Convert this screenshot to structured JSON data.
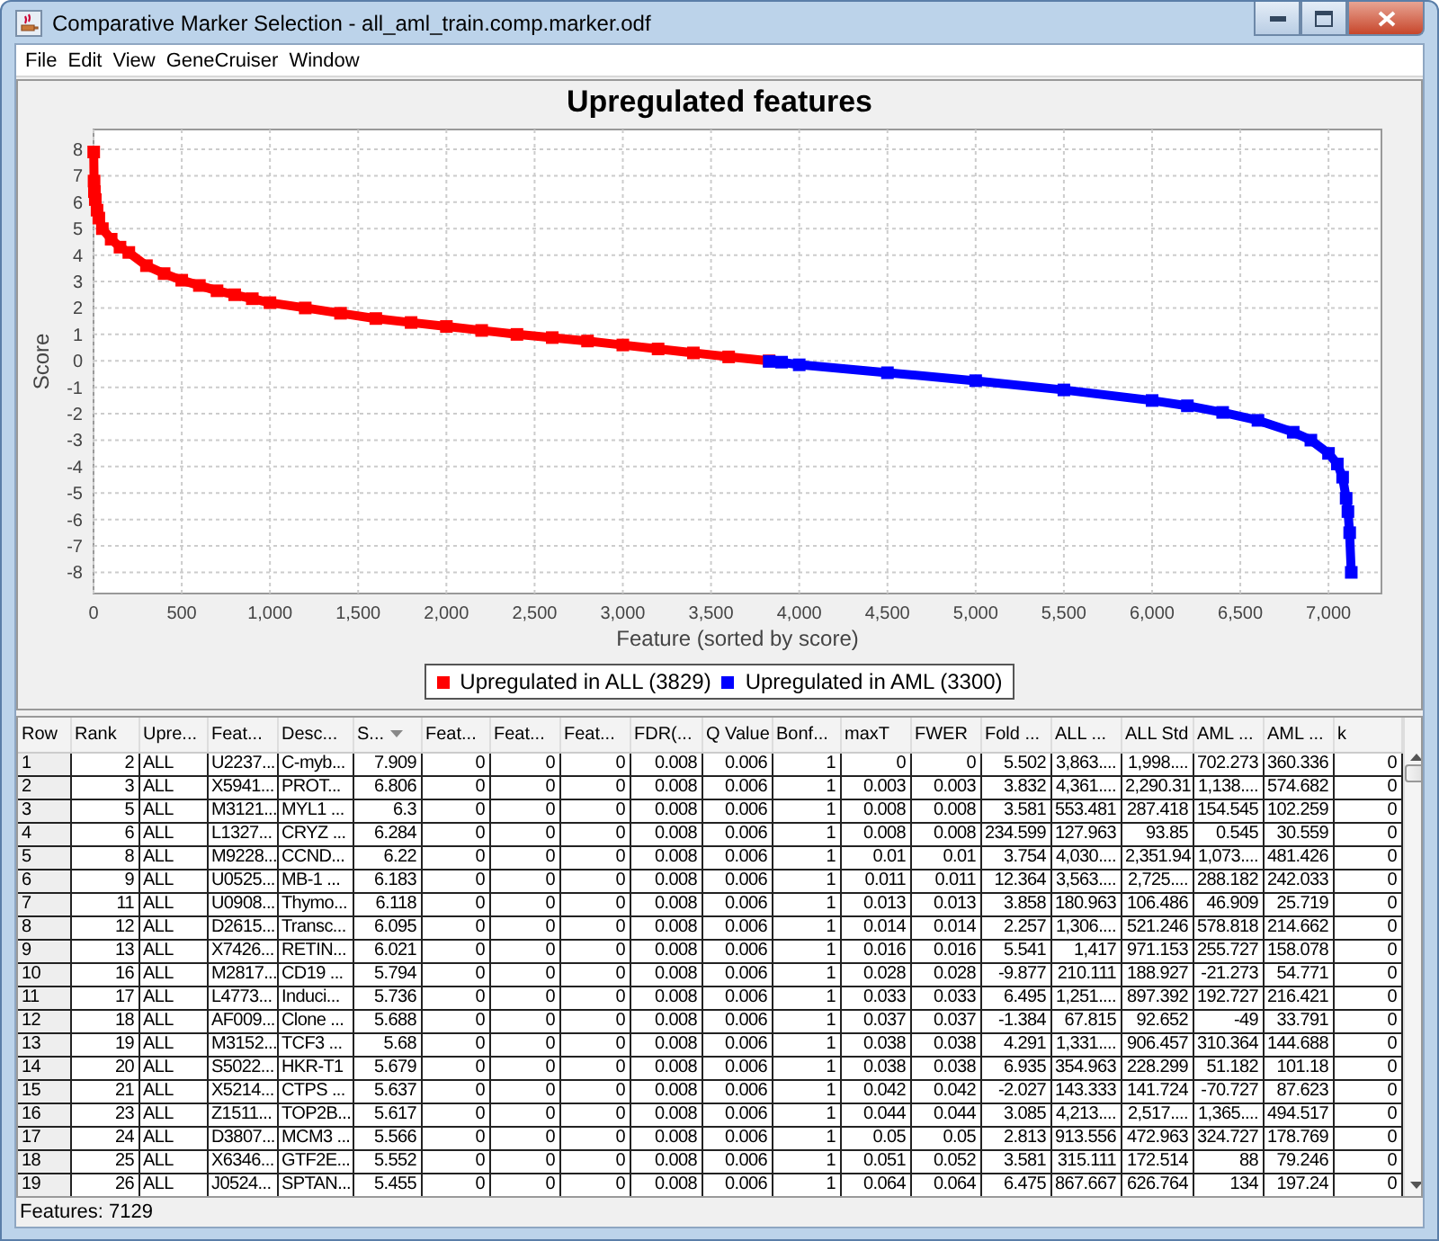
{
  "window": {
    "title": "Comparative Marker Selection - all_aml_train.comp.marker.odf"
  },
  "menu": [
    "File",
    "Edit",
    "View",
    "GeneCruiser",
    "Window"
  ],
  "chart": {
    "chart_data": {
      "type": "line",
      "title": "Upregulated features",
      "xlabel": "Feature (sorted by score)",
      "ylabel": "Score",
      "grid": true,
      "x": [
        1,
        3,
        5,
        10,
        20,
        30,
        50,
        100,
        150,
        200,
        300,
        400,
        500,
        600,
        700,
        800,
        900,
        1000,
        1200,
        1400,
        1600,
        1800,
        2000,
        2200,
        2400,
        2600,
        2800,
        3000,
        3200,
        3400,
        3600,
        3829,
        3830,
        3900,
        4000,
        4500,
        5000,
        5500,
        6000,
        6200,
        6400,
        6600,
        6800,
        6900,
        7000,
        7050,
        7080,
        7100,
        7110,
        7120,
        7129
      ],
      "series": [
        {
          "name": "Upregulated in ALL (3829)",
          "color": "#ff0000",
          "marker": "square",
          "values": [
            7.9,
            6.8,
            6.4,
            6.1,
            5.7,
            5.4,
            5.0,
            4.6,
            4.3,
            4.1,
            3.6,
            3.3,
            3.05,
            2.85,
            2.65,
            2.5,
            2.35,
            2.2,
            2.0,
            1.8,
            1.6,
            1.45,
            1.3,
            1.15,
            1.0,
            0.88,
            0.75,
            0.6,
            0.45,
            0.3,
            0.15,
            0.0,
            null,
            null,
            null,
            null,
            null,
            null,
            null,
            null,
            null,
            null,
            null,
            null,
            null,
            null,
            null,
            null,
            null,
            null,
            null
          ]
        },
        {
          "name": "Upregulated in AML (3300)",
          "color": "#0000ff",
          "marker": "square",
          "values": [
            null,
            null,
            null,
            null,
            null,
            null,
            null,
            null,
            null,
            null,
            null,
            null,
            null,
            null,
            null,
            null,
            null,
            null,
            null,
            null,
            null,
            null,
            null,
            null,
            null,
            null,
            null,
            null,
            null,
            null,
            null,
            null,
            -0.02,
            -0.05,
            -0.15,
            -0.45,
            -0.75,
            -1.1,
            -1.5,
            -1.7,
            -1.95,
            -2.25,
            -2.7,
            -3.0,
            -3.5,
            -3.9,
            -4.4,
            -5.2,
            -5.7,
            -6.5,
            -8.0
          ]
        }
      ],
      "xlim": [
        0,
        7300
      ],
      "ylim": [
        -8.8,
        8.75
      ],
      "xticks": [
        {
          "value": 0,
          "label": "0"
        },
        {
          "value": 500,
          "label": "500"
        },
        {
          "value": 1000,
          "label": "1,000"
        },
        {
          "value": 1500,
          "label": "1,500"
        },
        {
          "value": 2000,
          "label": "2,000"
        },
        {
          "value": 2500,
          "label": "2,500"
        },
        {
          "value": 3000,
          "label": "3,000"
        },
        {
          "value": 3500,
          "label": "3,500"
        },
        {
          "value": 4000,
          "label": "4,000"
        },
        {
          "value": 4500,
          "label": "4,500"
        },
        {
          "value": 5000,
          "label": "5,000"
        },
        {
          "value": 5500,
          "label": "5,500"
        },
        {
          "value": 6000,
          "label": "6,000"
        },
        {
          "value": 6500,
          "label": "6,500"
        },
        {
          "value": 7000,
          "label": "7,000"
        }
      ],
      "yticks": [
        -8,
        -7,
        -6,
        -5,
        -4,
        -3,
        -2,
        -1,
        0,
        1,
        2,
        3,
        4,
        5,
        6,
        7,
        8
      ]
    }
  },
  "table": {
    "columns": [
      {
        "label": "Row",
        "kind": "row",
        "sorted": false
      },
      {
        "label": "Rank",
        "kind": "number",
        "sorted": false
      },
      {
        "label": "Upre...",
        "kind": "text",
        "sorted": false
      },
      {
        "label": "Feat...",
        "kind": "text",
        "sorted": false
      },
      {
        "label": "Desc...",
        "kind": "text",
        "sorted": false
      },
      {
        "label": "S...",
        "kind": "number",
        "sorted": true
      },
      {
        "label": "Feat...",
        "kind": "number",
        "sorted": false
      },
      {
        "label": "Feat...",
        "kind": "number",
        "sorted": false
      },
      {
        "label": "Feat...",
        "kind": "number",
        "sorted": false
      },
      {
        "label": "FDR(...",
        "kind": "number",
        "sorted": false
      },
      {
        "label": "Q Value",
        "kind": "number",
        "sorted": false
      },
      {
        "label": "Bonf...",
        "kind": "number",
        "sorted": false
      },
      {
        "label": "maxT",
        "kind": "number",
        "sorted": false
      },
      {
        "label": "FWER",
        "kind": "number",
        "sorted": false
      },
      {
        "label": "Fold ...",
        "kind": "number",
        "sorted": false
      },
      {
        "label": "ALL ...",
        "kind": "number",
        "sorted": false
      },
      {
        "label": "ALL Std",
        "kind": "number",
        "sorted": false
      },
      {
        "label": "AML ...",
        "kind": "number",
        "sorted": false
      },
      {
        "label": "AML ...",
        "kind": "number",
        "sorted": false
      },
      {
        "label": "k",
        "kind": "number",
        "sorted": false
      }
    ],
    "rows": [
      [
        "1",
        "2",
        "ALL",
        "U2237...",
        "C-myb...",
        "7.909",
        "0",
        "0",
        "0",
        "0.008",
        "0.006",
        "1",
        "0",
        "0",
        "5.502",
        "3,863....",
        "1,998....",
        "702.273",
        "360.336",
        "0"
      ],
      [
        "2",
        "3",
        "ALL",
        "X5941...",
        "PROT...",
        "6.806",
        "0",
        "0",
        "0",
        "0.008",
        "0.006",
        "1",
        "0.003",
        "0.003",
        "3.832",
        "4,361....",
        "2,290.31",
        "1,138....",
        "574.682",
        "0"
      ],
      [
        "3",
        "5",
        "ALL",
        "M3121...",
        "MYL1 ...",
        "6.3",
        "0",
        "0",
        "0",
        "0.008",
        "0.006",
        "1",
        "0.008",
        "0.008",
        "3.581",
        "553.481",
        "287.418",
        "154.545",
        "102.259",
        "0"
      ],
      [
        "4",
        "6",
        "ALL",
        "L1327...",
        "CRYZ ...",
        "6.284",
        "0",
        "0",
        "0",
        "0.008",
        "0.006",
        "1",
        "0.008",
        "0.008",
        "234.599",
        "127.963",
        "93.85",
        "0.545",
        "30.559",
        "0"
      ],
      [
        "5",
        "8",
        "ALL",
        "M9228...",
        "CCND...",
        "6.22",
        "0",
        "0",
        "0",
        "0.008",
        "0.006",
        "1",
        "0.01",
        "0.01",
        "3.754",
        "4,030....",
        "2,351.94",
        "1,073....",
        "481.426",
        "0"
      ],
      [
        "6",
        "9",
        "ALL",
        "U0525...",
        "MB-1 ...",
        "6.183",
        "0",
        "0",
        "0",
        "0.008",
        "0.006",
        "1",
        "0.011",
        "0.011",
        "12.364",
        "3,563....",
        "2,725....",
        "288.182",
        "242.033",
        "0"
      ],
      [
        "7",
        "11",
        "ALL",
        "U0908...",
        "Thymo...",
        "6.118",
        "0",
        "0",
        "0",
        "0.008",
        "0.006",
        "1",
        "0.013",
        "0.013",
        "3.858",
        "180.963",
        "106.486",
        "46.909",
        "25.719",
        "0"
      ],
      [
        "8",
        "12",
        "ALL",
        "D2615...",
        "Transc...",
        "6.095",
        "0",
        "0",
        "0",
        "0.008",
        "0.006",
        "1",
        "0.014",
        "0.014",
        "2.257",
        "1,306....",
        "521.246",
        "578.818",
        "214.662",
        "0"
      ],
      [
        "9",
        "13",
        "ALL",
        "X7426...",
        "RETIN...",
        "6.021",
        "0",
        "0",
        "0",
        "0.008",
        "0.006",
        "1",
        "0.016",
        "0.016",
        "5.541",
        "1,417",
        "971.153",
        "255.727",
        "158.078",
        "0"
      ],
      [
        "10",
        "16",
        "ALL",
        "M2817...",
        "CD19 ...",
        "5.794",
        "0",
        "0",
        "0",
        "0.008",
        "0.006",
        "1",
        "0.028",
        "0.028",
        "-9.877",
        "210.111",
        "188.927",
        "-21.273",
        "54.771",
        "0"
      ],
      [
        "11",
        "17",
        "ALL",
        "L4773...",
        "Induci...",
        "5.736",
        "0",
        "0",
        "0",
        "0.008",
        "0.006",
        "1",
        "0.033",
        "0.033",
        "6.495",
        "1,251....",
        "897.392",
        "192.727",
        "216.421",
        "0"
      ],
      [
        "12",
        "18",
        "ALL",
        "AF009...",
        "Clone ...",
        "5.688",
        "0",
        "0",
        "0",
        "0.008",
        "0.006",
        "1",
        "0.037",
        "0.037",
        "-1.384",
        "67.815",
        "92.652",
        "-49",
        "33.791",
        "0"
      ],
      [
        "13",
        "19",
        "ALL",
        "M3152...",
        "TCF3 ...",
        "5.68",
        "0",
        "0",
        "0",
        "0.008",
        "0.006",
        "1",
        "0.038",
        "0.038",
        "4.291",
        "1,331....",
        "906.457",
        "310.364",
        "144.688",
        "0"
      ],
      [
        "14",
        "20",
        "ALL",
        "S5022...",
        "HKR-T1",
        "5.679",
        "0",
        "0",
        "0",
        "0.008",
        "0.006",
        "1",
        "0.038",
        "0.038",
        "6.935",
        "354.963",
        "228.299",
        "51.182",
        "101.18",
        "0"
      ],
      [
        "15",
        "21",
        "ALL",
        "X5214...",
        "CTPS ...",
        "5.637",
        "0",
        "0",
        "0",
        "0.008",
        "0.006",
        "1",
        "0.042",
        "0.042",
        "-2.027",
        "143.333",
        "141.724",
        "-70.727",
        "87.623",
        "0"
      ],
      [
        "16",
        "23",
        "ALL",
        "Z1511...",
        "TOP2B...",
        "5.617",
        "0",
        "0",
        "0",
        "0.008",
        "0.006",
        "1",
        "0.044",
        "0.044",
        "3.085",
        "4,213....",
        "2,517....",
        "1,365....",
        "494.517",
        "0"
      ],
      [
        "17",
        "24",
        "ALL",
        "D3807...",
        "MCM3 ...",
        "5.566",
        "0",
        "0",
        "0",
        "0.008",
        "0.006",
        "1",
        "0.05",
        "0.05",
        "2.813",
        "913.556",
        "472.963",
        "324.727",
        "178.769",
        "0"
      ],
      [
        "18",
        "25",
        "ALL",
        "X6346...",
        "GTF2E...",
        "5.552",
        "0",
        "0",
        "0",
        "0.008",
        "0.006",
        "1",
        "0.051",
        "0.052",
        "3.581",
        "315.111",
        "172.514",
        "88",
        "79.246",
        "0"
      ],
      [
        "19",
        "26",
        "ALL",
        "J0524...",
        "SPTAN...",
        "5.455",
        "0",
        "0",
        "0",
        "0.008",
        "0.006",
        "1",
        "0.064",
        "0.064",
        "6.475",
        "867.667",
        "626.764",
        "134",
        "197.24",
        "0"
      ]
    ]
  },
  "status_bar": "Features: 7129"
}
